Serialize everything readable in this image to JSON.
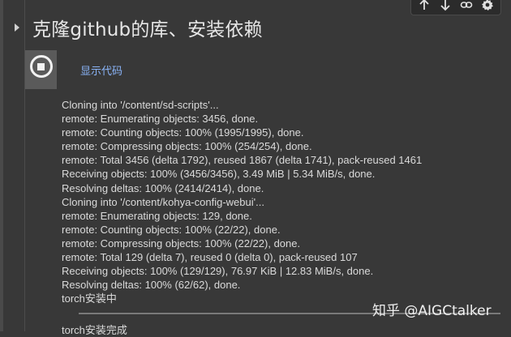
{
  "cell": {
    "title": "克隆github的库、安装依赖",
    "show_code_label": "显示代码"
  },
  "toolbar": {
    "icons": [
      "arrow-up-icon",
      "arrow-down-icon",
      "link-icon",
      "gear-icon"
    ]
  },
  "output": {
    "lines": [
      "Cloning into '/content/sd-scripts'...",
      "remote: Enumerating objects: 3456, done.",
      "remote: Counting objects: 100% (1995/1995), done.",
      "remote: Compressing objects: 100% (254/254), done.",
      "remote: Total 3456 (delta 1792), reused 1867 (delta 1741), pack-reused 1461",
      "Receiving objects: 100% (3456/3456), 3.49 MiB | 5.34 MiB/s, done.",
      "Resolving deltas: 100% (2414/2414), done.",
      "Cloning into '/content/kohya-config-webui'...",
      "remote: Enumerating objects: 129, done.",
      "remote: Counting objects: 100% (22/22), done.",
      "remote: Compressing objects: 100% (22/22), done.",
      "remote: Total 129 (delta 7), reused 0 (delta 0), pack-reused 107",
      "Receiving objects: 100% (129/129), 76.97 KiB | 12.83 MiB/s, done.",
      "Resolving deltas: 100% (62/62), done.",
      "torch安装中"
    ],
    "tail": "torch安装完成"
  },
  "watermark": "知乎 @AIGCtalker"
}
